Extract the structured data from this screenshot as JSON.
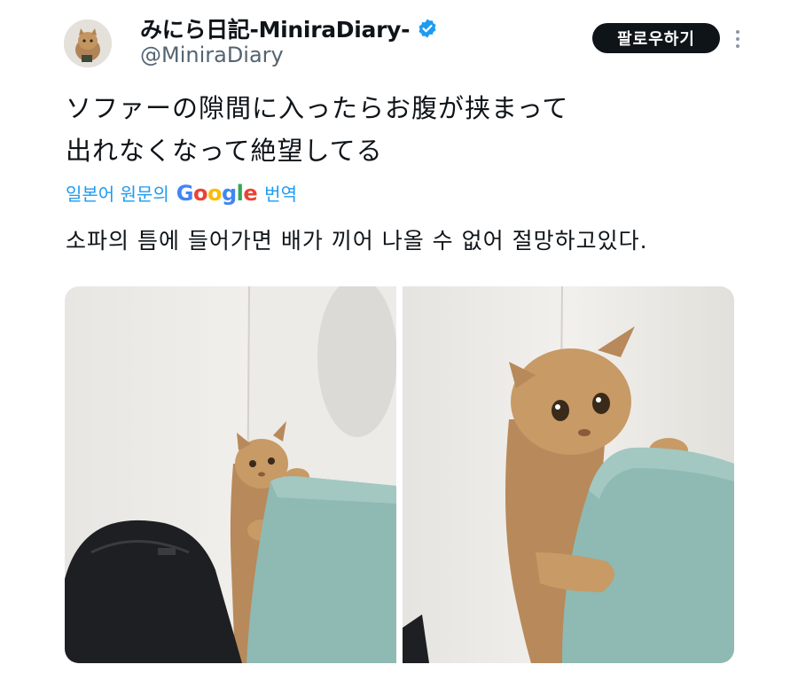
{
  "user": {
    "display_name": "みにら日記-MiniraDiary-",
    "handle": "@MiniraDiary",
    "verified_icon": "verified-badge-icon",
    "avatar_icon": "cat-avatar"
  },
  "actions": {
    "follow_label": "팔로우하기",
    "more_icon": "more-vertical-icon"
  },
  "tweet": {
    "lines": [
      "ソファーの隙間に入ったらお腹が挟まって",
      "出れなくなって絶望してる"
    ]
  },
  "translation": {
    "prefix": "일본어 원문의",
    "provider": "Google",
    "suffix": "번역",
    "text": "소파의 틈에 들어가면 배가 끼어 나올 수 없어 절망하고있다."
  },
  "media": {
    "photos": [
      "cat-in-sofa-gap-wide",
      "cat-in-sofa-gap-closeup"
    ]
  },
  "colors": {
    "link": "#1d9bf0",
    "verified": "#1d9bf0",
    "follow_bg": "#0f1419",
    "secondary_text": "#536471",
    "sofa": "#8fb9b3",
    "wall": "#eceae6",
    "cat": "#c79a66"
  }
}
